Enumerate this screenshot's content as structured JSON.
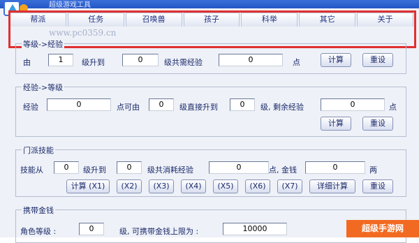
{
  "window": {
    "title": "超级游戏工具"
  },
  "tabs": [
    "帮派",
    "任务",
    "召唤兽",
    "孩子",
    "科举",
    "其它",
    "关于"
  ],
  "watermark": "www.pc0359.cn",
  "level_to_exp": {
    "title": "等级->经验",
    "from_label": "由",
    "from_value": "1",
    "upgrade_label": "级升到",
    "to_value": "0",
    "needed_label": "级共需经验",
    "needed_value": "0",
    "unit": "点",
    "calc_button": "计算",
    "reset_button": "重设"
  },
  "exp_to_level": {
    "title": "经验->等级",
    "exp_label": "经验",
    "exp_value": "0",
    "from_label": "点可由",
    "from_value": "0",
    "direct_label": "级直接升到",
    "to_value": "0",
    "remain_label": "级, 剩余经验",
    "remain_value": "0",
    "unit": "点",
    "calc_button": "计算",
    "reset_button": "重设"
  },
  "skill": {
    "title": "门派技能",
    "from_label": "技能从",
    "from_value": "0",
    "upgrade_label": "级升到",
    "to_value": "0",
    "cost_label": "级共消耗经验",
    "cost_value": "0",
    "money_label": "点, 金钱",
    "money_value": "0",
    "money_unit": "两",
    "buttons": [
      "计算 (X1)",
      "(X2)",
      "(X3)",
      "(X4)",
      "(X5)",
      "(X6)",
      "(X7)",
      "详细计算",
      "重设"
    ]
  },
  "money": {
    "title": "携带金钱",
    "level_label": "角色等级 :",
    "level_value": "0",
    "limit_label": "级, 可携带金钱上限为 :",
    "limit_value": "10000"
  },
  "corner_logo": "超级手游网",
  "colors": {
    "accent_red": "#e03030",
    "titlebar": "#2456c6",
    "logo_orange": "#f26a22"
  }
}
